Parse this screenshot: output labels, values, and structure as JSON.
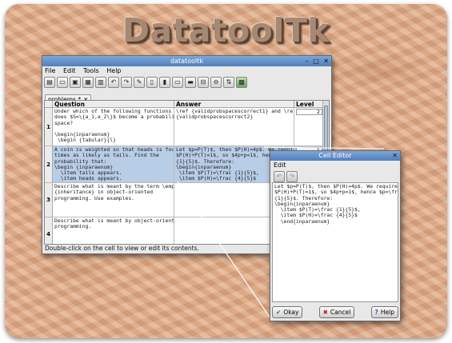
{
  "logo": "DatatoolTk",
  "main_window": {
    "title": "datatooltk",
    "controls": [
      "–",
      "□",
      "✕"
    ],
    "menu": [
      "File",
      "Edit",
      "Tools",
      "Help"
    ],
    "tab_label": "problems *",
    "tab_close": "✕",
    "columns": [
      "",
      "Question",
      "Answer",
      "Level"
    ],
    "rows": [
      {
        "num": "1",
        "question": "Under which of the following functions\ndoes $S=\\{a_1,a_2\\}$ become a probability\nspace?\n\n\\begin{inparaenum}\n \\begin {tabular}{l}",
        "answer": "\\ref {validprobspacescorrect1} and \\ref\n{validprobspacescorrect2}",
        "level": "2"
      },
      {
        "num": "2",
        "question": "A coin is weighted so that heads is four\ntimes as likely as tails. Find the\nprobability that:\n\\begin {inparaenum}\n  \\item tails appears.\n  \\item heads appears.",
        "answer": "Let $p=P(T)$, then $P(H)=4p$. We require\n$P(H)+P(T)=1$, so $4p+p=1$, hence $p=\\frac\n{1}{5}$. Therefore:\n\\begin{inparaenum}\n \\item $P(T)=\\frac {1}{5}$,\n \\item $P(H)=\\frac {4}{5}$",
        "level": "1"
      },
      {
        "num": "3",
        "question": "Describe what is meant by the term \\emph\n{inheritance} in object-oriented\nprogramming. Use examples.",
        "answer": "",
        "level": ""
      },
      {
        "num": "4",
        "question": "Describe what is meant by object-oriented\nprogramming.",
        "answer": "",
        "level": ""
      }
    ],
    "status": "Double-click on the cell to view or edit its contents."
  },
  "cell_editor": {
    "title": "Cell Editor",
    "close": "✕",
    "menu": [
      "Edit"
    ],
    "text": "Let $p=P(T)$, then $P(H)=4p$. We require\n$P(H)+P(T)=1$, so $4p+p=1$, hence $p=\\frac\n{1}{5}$. Therefore:\n\\begin{inparaenum}\n  \\item $P(T)=\\frac {1}{5}$,\n  \\item $P(H)=\\frac {4}{5}$\n  \\end{inparaenum}",
    "buttons": {
      "okay": "Okay",
      "cancel": "Cancel",
      "help": "Help"
    },
    "icons": {
      "okay": "✔",
      "cancel": "✖",
      "help": "?"
    }
  }
}
